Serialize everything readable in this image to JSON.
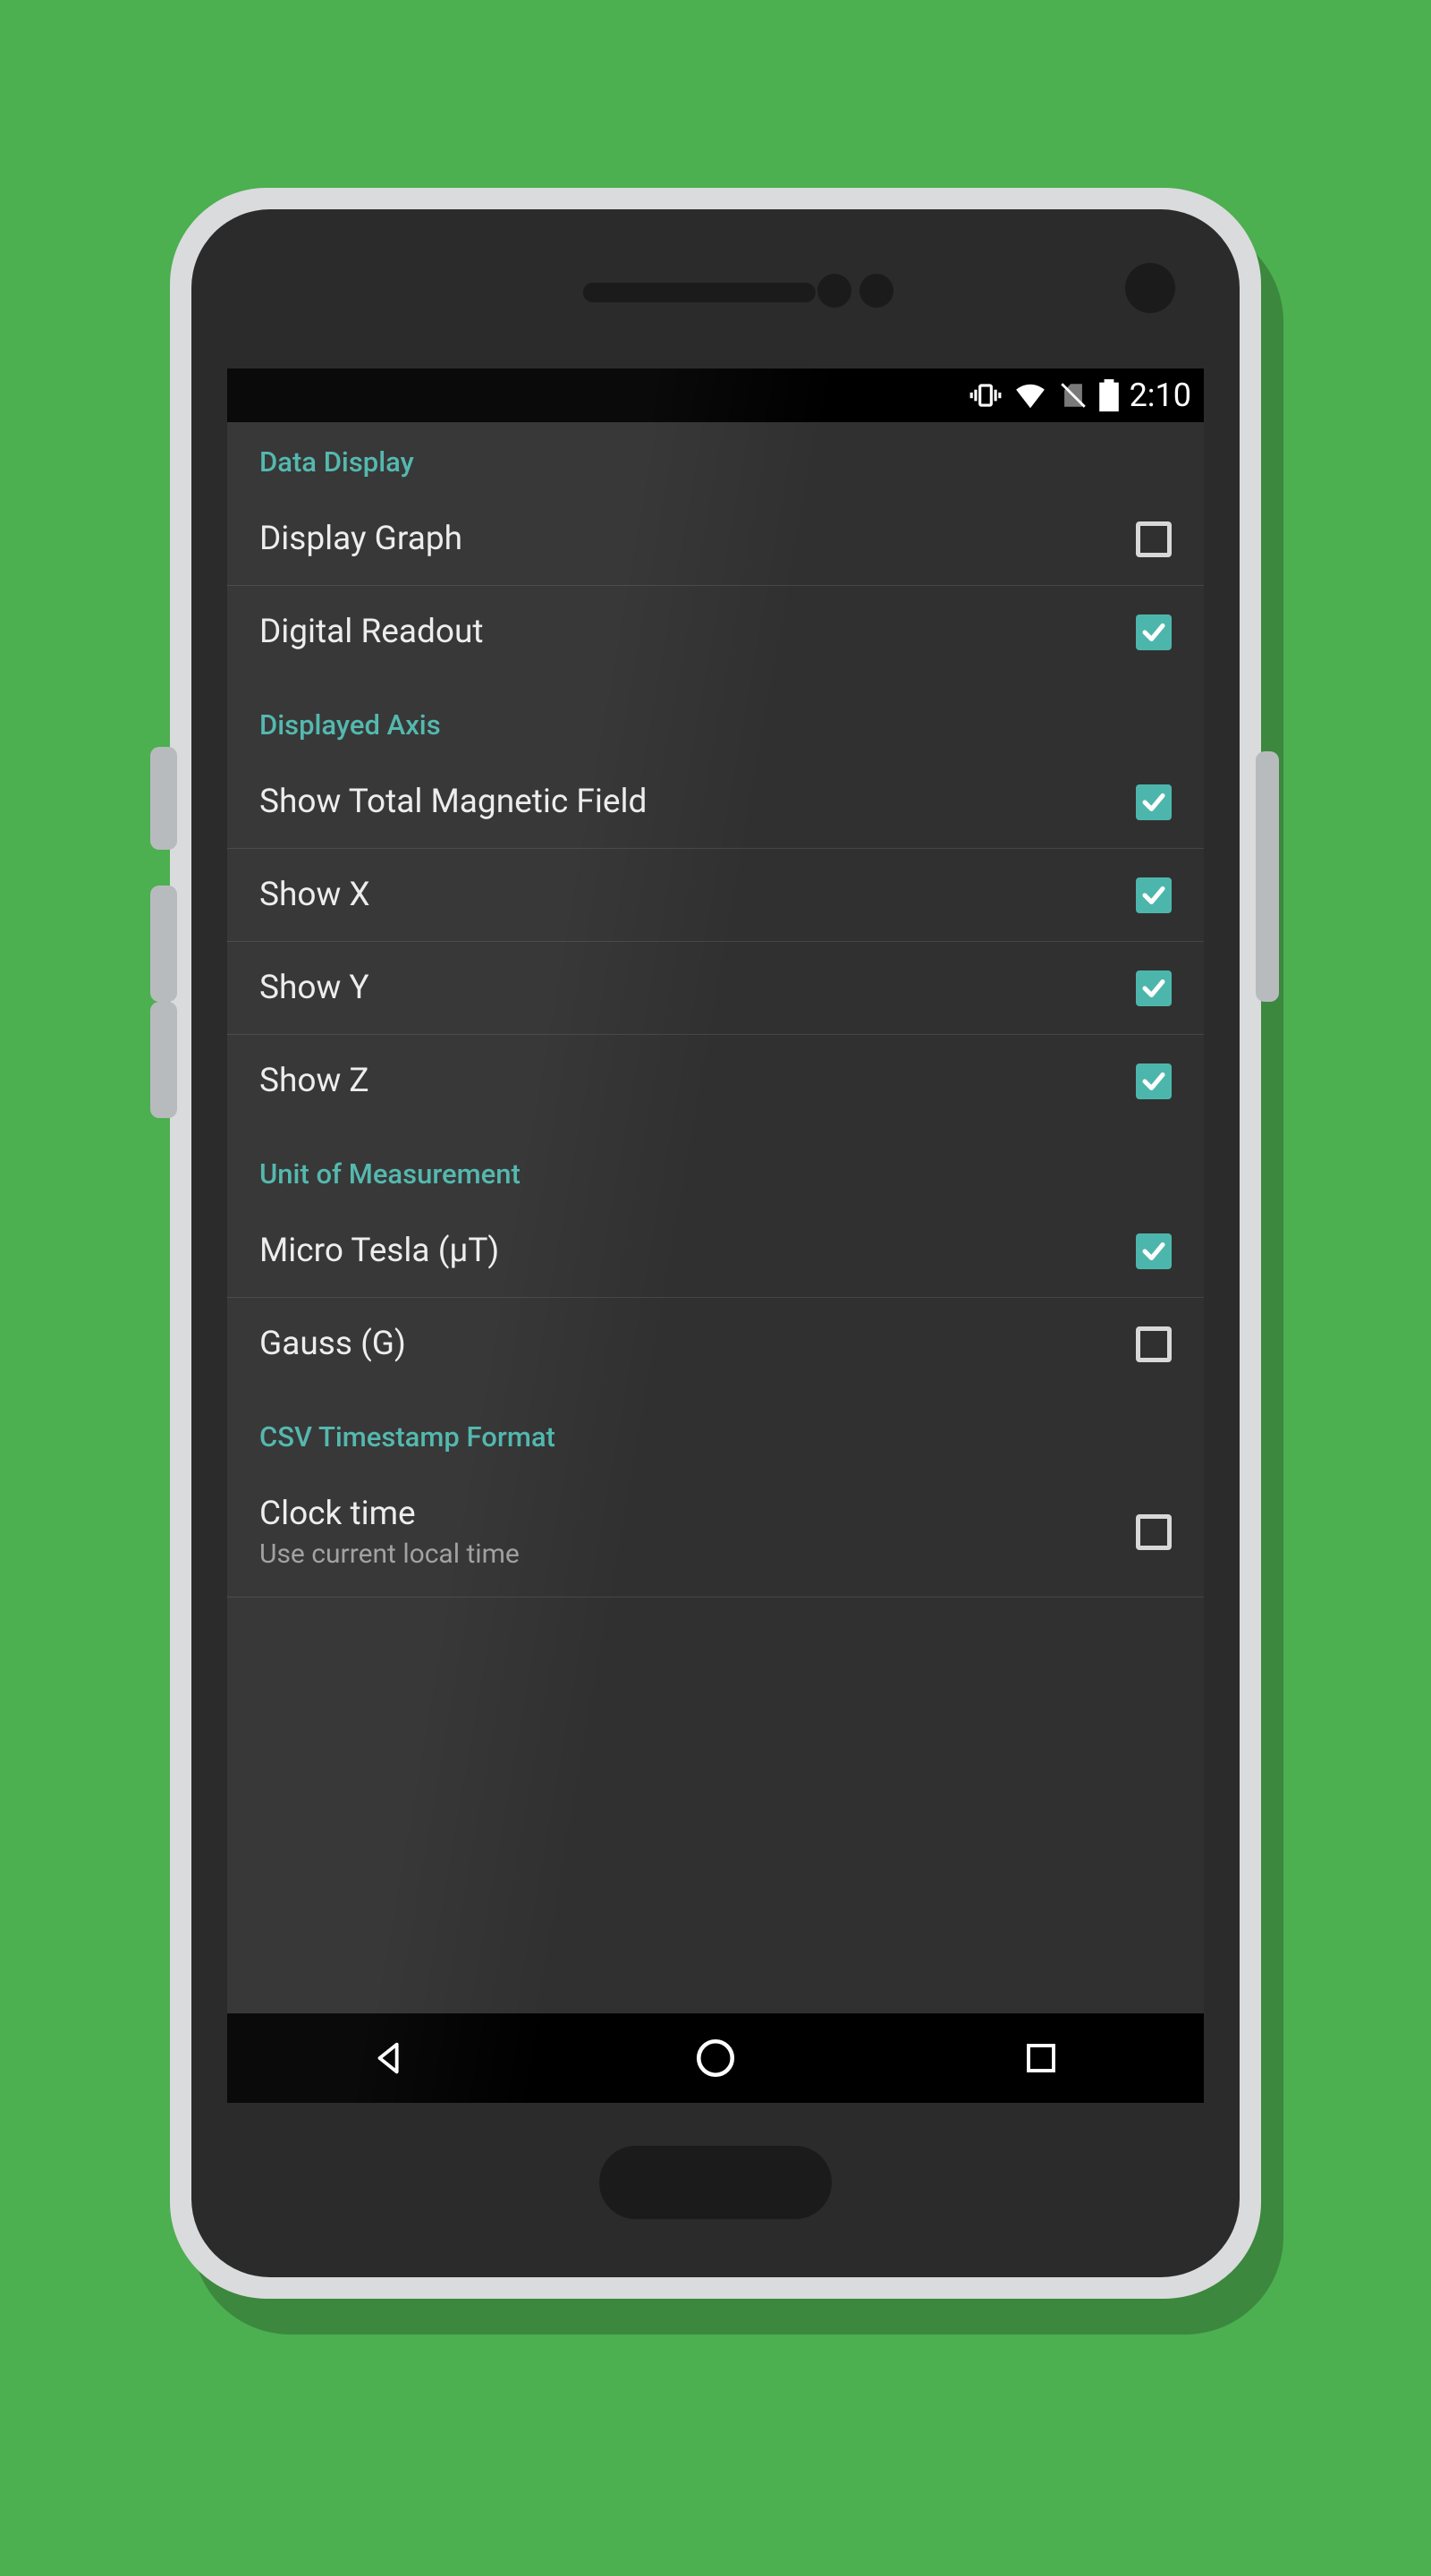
{
  "statusbar": {
    "time": "2:10"
  },
  "sections": [
    {
      "title": "Data Display",
      "items": [
        {
          "label": "Display Graph",
          "checked": false
        },
        {
          "label": "Digital Readout",
          "checked": true
        }
      ]
    },
    {
      "title": "Displayed Axis",
      "items": [
        {
          "label": "Show Total Magnetic Field",
          "checked": true
        },
        {
          "label": "Show X",
          "checked": true
        },
        {
          "label": "Show Y",
          "checked": true
        },
        {
          "label": "Show Z",
          "checked": true
        }
      ]
    },
    {
      "title": "Unit of Measurement",
      "items": [
        {
          "label": "Micro Tesla (μT)",
          "checked": true
        },
        {
          "label": "Gauss (G)",
          "checked": false
        }
      ]
    },
    {
      "title": "CSV Timestamp Format",
      "items": [
        {
          "label": "Clock time",
          "subtitle": "Use current local time",
          "checked": false
        }
      ]
    }
  ],
  "colors": {
    "accent": "#4DB6AC",
    "background": "#303030",
    "pageBackground": "#4CAF50"
  }
}
